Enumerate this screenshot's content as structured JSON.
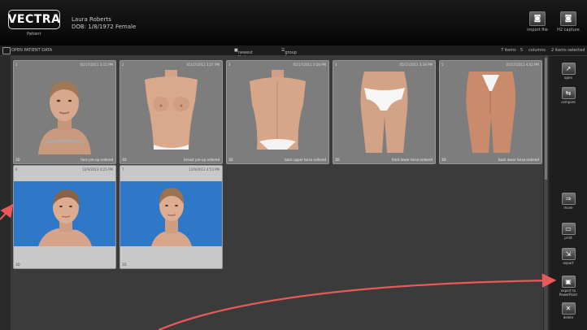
{
  "header": {
    "logo": "VECTRA",
    "logo_sub": "Patient",
    "patient_name": "Laura Roberts",
    "patient_dob": "DOB: 1/8/1972   Female",
    "buttons": [
      {
        "label": "import file",
        "icon": "camera-icon"
      },
      {
        "label": "H2 capture",
        "icon": "camera-icon"
      }
    ]
  },
  "toolbar": {
    "open_patient": "OPEN PATIENT DATA",
    "newest_first": "newest first",
    "group_by_date": "group by date",
    "items_count": "7 items",
    "columns_value": "5",
    "columns_label": "columns",
    "selected": "2 items selected"
  },
  "cards": [
    {
      "id": "1",
      "date": "05/17/2011 3:15 PM",
      "mode": "3D",
      "caption": "face pre-op ordered",
      "kind": "face",
      "bg": "gray"
    },
    {
      "id": "2",
      "date": "05/17/2011 3:27 PM",
      "mode": "3D",
      "caption": "breast pre-op ordered",
      "kind": "torso-front",
      "bg": "gray"
    },
    {
      "id": "3",
      "date": "05/17/2011 3:28 PM",
      "mode": "3D",
      "caption": "back upper torso ordered",
      "kind": "torso-back",
      "bg": "gray"
    },
    {
      "id": "4",
      "date": "05/17/2011 3:39 PM",
      "mode": "3D",
      "caption": "front lower torso ordered",
      "kind": "hips-front",
      "bg": "gray"
    },
    {
      "id": "5",
      "date": "05/17/2011 4:02 PM",
      "mode": "3D",
      "caption": "back lower torso ordered",
      "kind": "hips-back",
      "bg": "gray"
    },
    {
      "id": "6",
      "date": "12/9/2013 4:25 PM",
      "mode": "3D",
      "caption": "",
      "kind": "face-side",
      "bg": "blue"
    },
    {
      "id": "7",
      "date": "12/9/2013 4:53 PM",
      "mode": "3D",
      "caption": "",
      "kind": "face-front",
      "bg": "blue"
    }
  ],
  "sidebar": [
    {
      "label": "open",
      "icon": "open-icon"
    },
    {
      "label": "compare",
      "icon": "compare-icon"
    },
    {
      "label": "move",
      "icon": "move-icon"
    },
    {
      "label": "print",
      "icon": "print-icon"
    },
    {
      "label": "export",
      "icon": "export-icon"
    },
    {
      "label": "export to PowerPoint",
      "icon": "powerpoint-icon"
    },
    {
      "label": "delete",
      "icon": "delete-icon"
    }
  ],
  "colors": {
    "accent_arrow": "#e85a5a",
    "image_bg_blue": "#2f78c8"
  }
}
